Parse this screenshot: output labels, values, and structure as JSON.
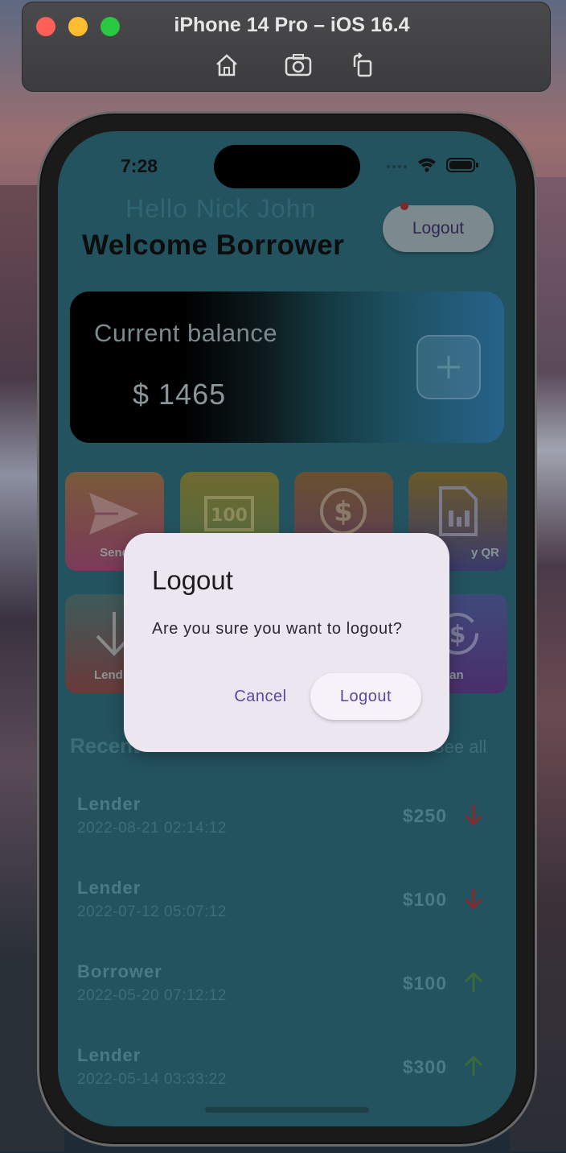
{
  "simulator": {
    "title": "iPhone 14 Pro – iOS 16.4",
    "toolbar_icons": [
      "home-icon",
      "screenshot-icon",
      "rotate-icon"
    ]
  },
  "status_bar": {
    "time": "7:28"
  },
  "header": {
    "greeting": "Hello Nick John",
    "welcome": "Welcome Borrower",
    "logout_label": "Logout"
  },
  "balance": {
    "label": "Current balance",
    "value": "$ 1465"
  },
  "actions": [
    {
      "label": "Send",
      "icon": "send-icon"
    },
    {
      "label": "",
      "icon": "banknote-icon"
    },
    {
      "label": "",
      "icon": "dollar-icon"
    },
    {
      "label": "Pay QR",
      "icon": "sim-card-icon"
    },
    {
      "label": "Lend",
      "icon": "arrow-down-icon"
    },
    {
      "label": "Loan",
      "icon": "exchange-icon"
    }
  ],
  "action_labels_visible": {
    "t1": "Send",
    "t4": "y QR",
    "t5": "Lend",
    "t8": "oan"
  },
  "recent": {
    "title": "Recent",
    "see_all": "See all"
  },
  "transactions": [
    {
      "name": "Lender",
      "date": "2022-08-21 02:14:12",
      "amount": "$250",
      "direction": "down"
    },
    {
      "name": "Lender",
      "date": "2022-07-12 05:07:12",
      "amount": "$100",
      "direction": "down"
    },
    {
      "name": "Borrower",
      "date": "2022-05-20 07:12:12",
      "amount": "$100",
      "direction": "up"
    },
    {
      "name": "Lender",
      "date": "2022-05-14 03:33:22",
      "amount": "$300",
      "direction": "up"
    }
  ],
  "dialog": {
    "title": "Logout",
    "message": "Are you sure you want to logout?",
    "cancel_label": "Cancel",
    "confirm_label": "Logout"
  },
  "colors": {
    "arrow_down": "#8a2a2a",
    "arrow_up": "#3a6a3a",
    "dialog_bg": "#ece6f0",
    "dialog_button_text": "#5a4a98"
  }
}
